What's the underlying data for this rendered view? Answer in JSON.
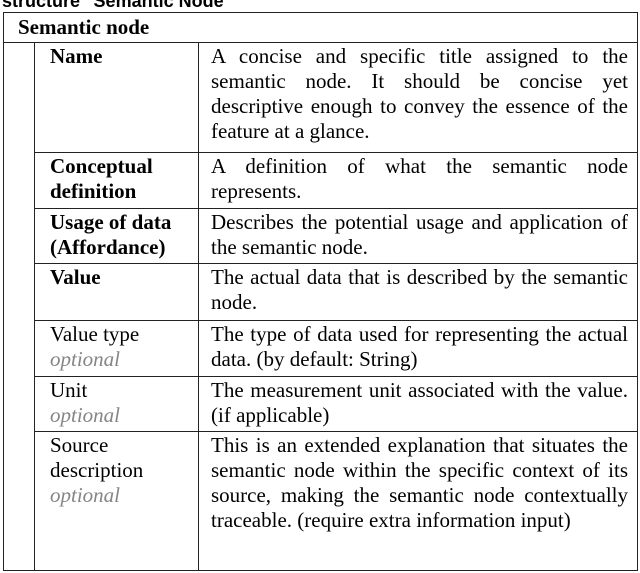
{
  "caption": "structure \"Semantic Node\"",
  "table": {
    "header": "Semantic node",
    "rows": [
      {
        "name": "Name",
        "bold": true,
        "optional": "",
        "description": "A concise and specific title assigned to the semantic node. It should be concise yet descriptive enough to convey the essence of the feature at a glance."
      },
      {
        "name": "Conceptual definition",
        "bold": true,
        "optional": "",
        "description": "A definition of what the semantic node represents."
      },
      {
        "name": "Usage of data (Affordance)",
        "bold": true,
        "optional": "",
        "description": "Describes the potential usage and application of the semantic node."
      },
      {
        "name": "Value",
        "bold": true,
        "optional": "",
        "description": "The actual data that is described by the semantic node."
      },
      {
        "name": "Value type",
        "bold": false,
        "optional": "optional",
        "description": "The type of data used for representing the actual data. (by default: String)"
      },
      {
        "name": "Unit",
        "bold": false,
        "optional": "optional",
        "description": "The measurement unit associated with the value. (if applicable)"
      },
      {
        "name": "Source description",
        "bold": false,
        "optional": "optional",
        "description": "This is an extended explanation that situates the semantic node within the specific context of its source, making the semantic node contextually traceable. (require extra information input)"
      }
    ]
  }
}
